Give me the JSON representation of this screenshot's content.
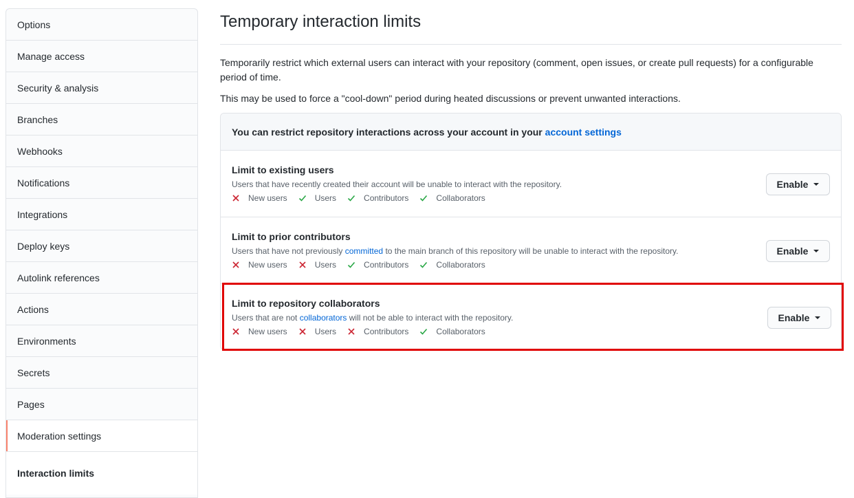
{
  "sidebar": {
    "items": [
      {
        "label": "Options"
      },
      {
        "label": "Manage access"
      },
      {
        "label": "Security & analysis"
      },
      {
        "label": "Branches"
      },
      {
        "label": "Webhooks"
      },
      {
        "label": "Notifications"
      },
      {
        "label": "Integrations"
      },
      {
        "label": "Deploy keys"
      },
      {
        "label": "Autolink references"
      },
      {
        "label": "Actions"
      },
      {
        "label": "Environments"
      },
      {
        "label": "Secrets"
      },
      {
        "label": "Pages"
      },
      {
        "label": "Moderation settings"
      }
    ],
    "subitem": "Interaction limits"
  },
  "main": {
    "title": "Temporary interaction limits",
    "description": "Temporarily restrict which external users can interact with your repository (comment, open issues, or create pull requests) for a configurable period of time.",
    "description2": "This may be used to force a \"cool-down\" period during heated discussions or prevent unwanted interactions.",
    "notice_prefix": "You can restrict repository interactions across your account in your ",
    "notice_link": "account settings",
    "button_label": "Enable",
    "rows": [
      {
        "title": "Limit to existing users",
        "desc_before": "Users that have recently created their account will be unable to interact with the repository.",
        "desc_link": "",
        "desc_after": "",
        "perms": [
          {
            "label": "New users",
            "allowed": false
          },
          {
            "label": "Users",
            "allowed": true
          },
          {
            "label": "Contributors",
            "allowed": true
          },
          {
            "label": "Collaborators",
            "allowed": true
          }
        ]
      },
      {
        "title": "Limit to prior contributors",
        "desc_before": "Users that have not previously ",
        "desc_link": "committed",
        "desc_after": " to the main branch of this repository will be unable to interact with the repository.",
        "perms": [
          {
            "label": "New users",
            "allowed": false
          },
          {
            "label": "Users",
            "allowed": false
          },
          {
            "label": "Contributors",
            "allowed": true
          },
          {
            "label": "Collaborators",
            "allowed": true
          }
        ]
      },
      {
        "title": "Limit to repository collaborators",
        "desc_before": "Users that are not ",
        "desc_link": "collaborators",
        "desc_after": " will not be able to interact with the repository.",
        "perms": [
          {
            "label": "New users",
            "allowed": false
          },
          {
            "label": "Users",
            "allowed": false
          },
          {
            "label": "Contributors",
            "allowed": false
          },
          {
            "label": "Collaborators",
            "allowed": true
          }
        ]
      }
    ]
  },
  "colors": {
    "deny": "#cb2431",
    "allow": "#28a745",
    "link": "#0366d6",
    "highlight": "#e00000"
  }
}
